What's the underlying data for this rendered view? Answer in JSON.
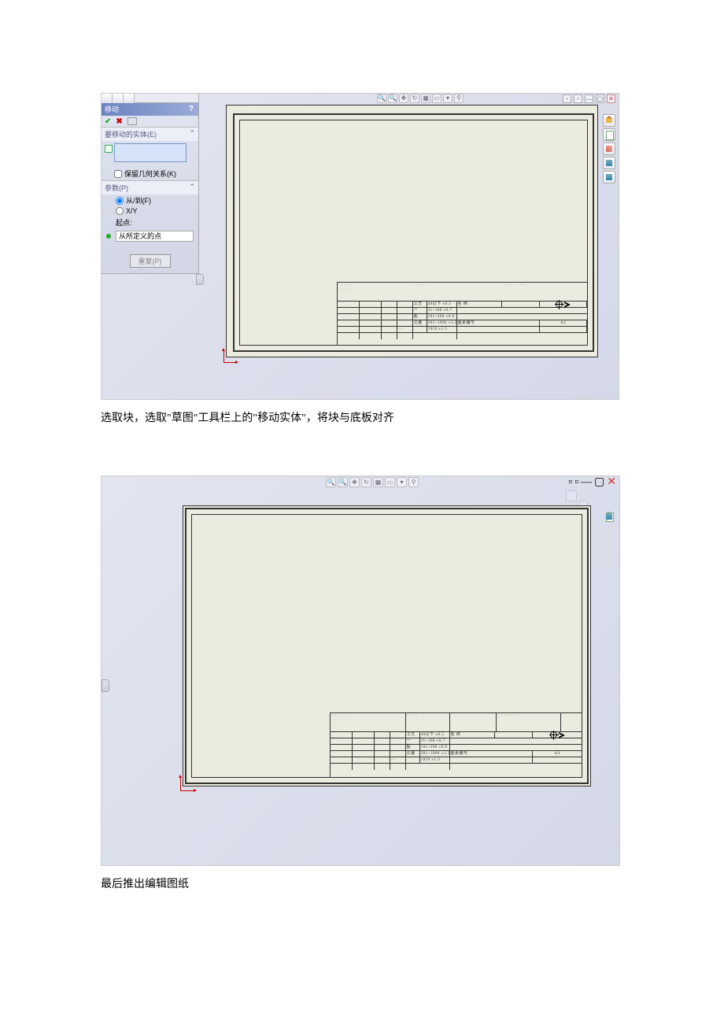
{
  "caption1": "选取块，选取\"草图\"工具栏上的\"移动实体\"，将块与底板对齐",
  "caption2": "最后推出编辑图纸",
  "panel": {
    "title": "移动",
    "entities_header": "要移动的实体(E)",
    "keep_relations": "保留几何关系(K)",
    "params_header": "参数(P)",
    "from_to": "从/到(F)",
    "xy": "X/Y",
    "start_point": "起点:",
    "defined_point": "从所定义的点",
    "repeat": "重复(P)"
  },
  "titleblock": {
    "label1": "工艺",
    "label2": "图素编号",
    "a4": "A4",
    "size1": "30以下  ±0.5",
    "size2": "31~100  ±0.7",
    "size3": "101~300  ±0.9",
    "size4": "301~1000 ±1.2",
    "size5": "1010  ±1.5"
  }
}
